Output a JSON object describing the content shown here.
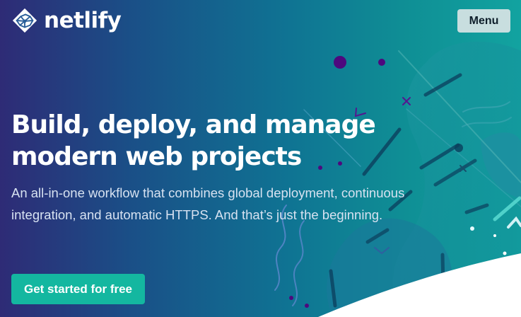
{
  "header": {
    "logo_text": "netlify",
    "menu_label": "Menu"
  },
  "hero": {
    "title": "Build, deploy, and manage modern web projects",
    "subtitle": "An all-in-one workflow that combines global deployment, continuous integration, and automatic HTTPS. And that’s just the beginning.",
    "cta_label": "Get started for free"
  },
  "icons": {
    "logo": "netlify-logo-icon"
  },
  "colors": {
    "background_start": "#2e2b76",
    "background_end": "#12a3a0",
    "accent_teal": "#14b7a0",
    "menu_button_background": "#c8dedf",
    "text_primary": "#ffffff",
    "text_secondary": "#d7e2f1"
  }
}
